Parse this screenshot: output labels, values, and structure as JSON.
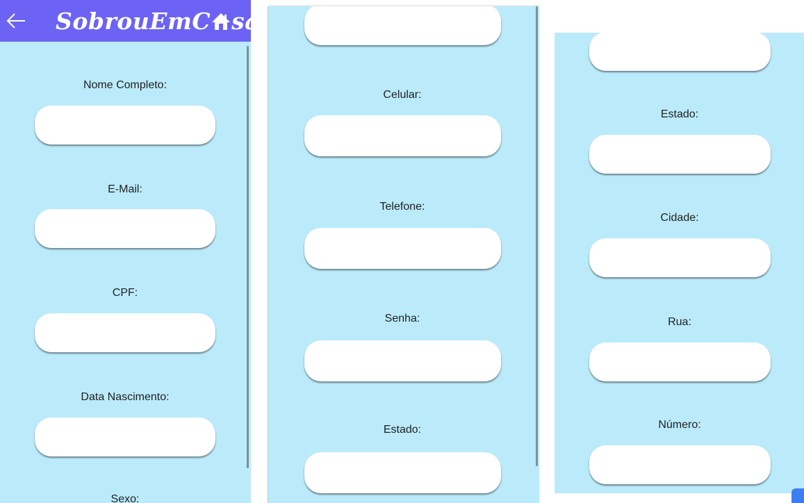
{
  "app": {
    "logo_prefix": "SobrouEmC",
    "logo_suffix": "sa",
    "back_icon": "arrow-left-icon",
    "colors": {
      "appbar": "#6c63f4",
      "background": "#bbebfb",
      "input": "#ffffff"
    }
  },
  "panel1": {
    "fields": [
      {
        "label": "Nome Completo:",
        "value": ""
      },
      {
        "label": "E-Mail:",
        "value": ""
      },
      {
        "label": "CPF:",
        "value": ""
      },
      {
        "label": "Data Nascimento:",
        "value": ""
      },
      {
        "label": "Sexo:"
      }
    ]
  },
  "panel2": {
    "fields": [
      {
        "value": ""
      },
      {
        "label": "Celular:",
        "value": ""
      },
      {
        "label": "Telefone:",
        "value": ""
      },
      {
        "label": "Senha:",
        "value": ""
      },
      {
        "label": "Estado:",
        "value": ""
      }
    ]
  },
  "panel3": {
    "fields": [
      {
        "value": ""
      },
      {
        "label": "Estado:",
        "value": ""
      },
      {
        "label": "Cidade:",
        "value": ""
      },
      {
        "label": "Rua:",
        "value": ""
      },
      {
        "label": "Número:",
        "value": ""
      }
    ]
  }
}
